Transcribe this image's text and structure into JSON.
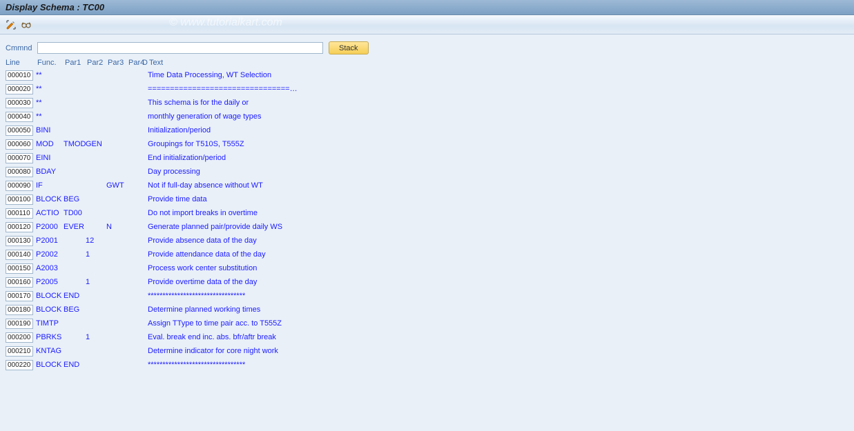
{
  "title": "Display Schema : TC00",
  "watermark": "© www.tutorialkart.com",
  "toolbar": {
    "cmd_label": "Cmmnd",
    "cmd_value": "",
    "stack_label": "Stack"
  },
  "headers": {
    "line": "Line",
    "func": "Func.",
    "par1": "Par1",
    "par2": "Par2",
    "par3": "Par3",
    "par4": "Par4",
    "d": "D",
    "text": "Text"
  },
  "rows": [
    {
      "line": "000010",
      "func": "**",
      "par1": "",
      "par2": "",
      "par3": "",
      "par4": "",
      "d": "",
      "text": "Time Data Processing, WT Selection"
    },
    {
      "line": "000020",
      "func": "**",
      "par1": "",
      "par2": "",
      "par3": "",
      "par4": "",
      "d": "",
      "text": "================================…"
    },
    {
      "line": "000030",
      "func": "**",
      "par1": "",
      "par2": "",
      "par3": "",
      "par4": "",
      "d": "",
      "text": "This schema is for the daily or"
    },
    {
      "line": "000040",
      "func": "**",
      "par1": "",
      "par2": "",
      "par3": "",
      "par4": "",
      "d": "",
      "text": "monthly generation of wage types"
    },
    {
      "line": "000050",
      "func": "BINI",
      "par1": "",
      "par2": "",
      "par3": "",
      "par4": "",
      "d": "",
      "text": "Initialization/period"
    },
    {
      "line": "000060",
      "func": "MOD",
      "par1": "TMOD",
      "par2": "GEN",
      "par3": "",
      "par4": "",
      "d": "",
      "text": "Groupings for T510S, T555Z"
    },
    {
      "line": "000070",
      "func": "EINI",
      "par1": "",
      "par2": "",
      "par3": "",
      "par4": "",
      "d": "",
      "text": "End initialization/period"
    },
    {
      "line": "000080",
      "func": "BDAY",
      "par1": "",
      "par2": "",
      "par3": "",
      "par4": "",
      "d": "",
      "text": "Day processing"
    },
    {
      "line": "000090",
      "func": "IF",
      "par1": "",
      "par2": "",
      "par3": "GWT",
      "par4": "",
      "d": "",
      "text": "Not if full-day absence without WT"
    },
    {
      "line": "000100",
      "func": "BLOCK",
      "par1": "BEG",
      "par2": "",
      "par3": "",
      "par4": "",
      "d": "",
      "text": "Provide time data"
    },
    {
      "line": "000110",
      "func": "ACTIO",
      "par1": "TD00",
      "par2": "",
      "par3": "",
      "par4": "",
      "d": "",
      "text": "Do not import breaks in overtime"
    },
    {
      "line": "000120",
      "func": "P2000",
      "par1": "EVER",
      "par2": "",
      "par3": "N",
      "par4": "",
      "d": "",
      "text": "Generate planned pair/provide daily WS"
    },
    {
      "line": "000130",
      "func": "P2001",
      "par1": "",
      "par2": "12",
      "par3": "",
      "par4": "",
      "d": "",
      "text": "Provide absence data of the day"
    },
    {
      "line": "000140",
      "func": "P2002",
      "par1": "",
      "par2": "1",
      "par3": "",
      "par4": "",
      "d": "",
      "text": "Provide attendance data of the day"
    },
    {
      "line": "000150",
      "func": "A2003",
      "par1": "",
      "par2": "",
      "par3": "",
      "par4": "",
      "d": "",
      "text": "Process work center substitution"
    },
    {
      "line": "000160",
      "func": "P2005",
      "par1": "",
      "par2": "1",
      "par3": "",
      "par4": "",
      "d": "",
      "text": "Provide overtime data of the day"
    },
    {
      "line": "000170",
      "func": "BLOCK",
      "par1": "END",
      "par2": "",
      "par3": "",
      "par4": "",
      "d": "",
      "text": "*********************************"
    },
    {
      "line": "000180",
      "func": "BLOCK",
      "par1": "BEG",
      "par2": "",
      "par3": "",
      "par4": "",
      "d": "",
      "text": "Determine planned working times"
    },
    {
      "line": "000190",
      "func": "TIMTP",
      "par1": "",
      "par2": "",
      "par3": "",
      "par4": "",
      "d": "",
      "text": "Assign TType to time pair acc. to T555Z"
    },
    {
      "line": "000200",
      "func": "PBRKS",
      "par1": "",
      "par2": "1",
      "par3": "",
      "par4": "",
      "d": "",
      "text": "Eval. break end inc. abs. bfr/aftr break"
    },
    {
      "line": "000210",
      "func": "KNTAG",
      "par1": "",
      "par2": "",
      "par3": "",
      "par4": "",
      "d": "",
      "text": "Determine indicator for core night work"
    },
    {
      "line": "000220",
      "func": "BLOCK",
      "par1": "END",
      "par2": "",
      "par3": "",
      "par4": "",
      "d": "",
      "text": "*********************************"
    }
  ]
}
